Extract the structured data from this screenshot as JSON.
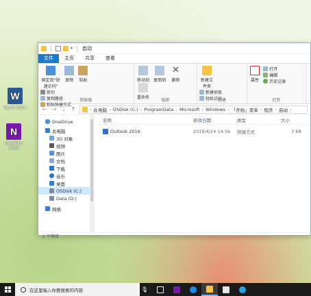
{
  "desktop": {
    "icons": [
      {
        "label": "Word 2016",
        "glyph": "W"
      },
      {
        "label": "OneNote 2016",
        "glyph": "N"
      }
    ]
  },
  "window": {
    "title": "启动",
    "tabs": [
      "文件",
      "主页",
      "共享",
      "查看"
    ],
    "ribbon": {
      "clipboard": {
        "pin": "固定到\"快速访问\"",
        "copy": "复制",
        "paste": "粘贴",
        "cut": "剪切",
        "copy_path": "复制路径",
        "paste_shortcut": "粘贴快捷方式",
        "label": "剪贴板"
      },
      "organize": {
        "move_to": "移动到",
        "copy_to": "复制到",
        "delete": "删除",
        "rename": "重命名",
        "label": "组织"
      },
      "new": {
        "new_folder": "新建文件夹",
        "new_item": "新建项目",
        "easy_access": "轻松访问",
        "label": "新建"
      },
      "open": {
        "properties": "属性",
        "open": "打开",
        "edit": "编辑",
        "history": "历史记录",
        "label": "打开"
      }
    },
    "address": {
      "crumbs": [
        "此电脑",
        "OSDisk (C:)",
        "ProgramData",
        "Microsoft",
        "Windows",
        "「开始」菜单",
        "程序",
        "启动"
      ]
    },
    "nav": {
      "items": [
        {
          "label": "OneDrive",
          "icon": "cloud-icon"
        },
        {
          "label": "此电脑",
          "icon": "computer-icon"
        },
        {
          "label": "3D 对象",
          "icon": "cube-icon"
        },
        {
          "label": "视频",
          "icon": "video-icon"
        },
        {
          "label": "图片",
          "icon": "picture-icon"
        },
        {
          "label": "文档",
          "icon": "document-icon"
        },
        {
          "label": "下载",
          "icon": "download-icon"
        },
        {
          "label": "音乐",
          "icon": "music-icon"
        },
        {
          "label": "桌面",
          "icon": "desktop-icon"
        },
        {
          "label": "OSDisk (C:)",
          "icon": "drive-icon"
        },
        {
          "label": "Data (D:)",
          "icon": "drive-icon"
        },
        {
          "label": "网络",
          "icon": "network-icon"
        }
      ]
    },
    "columns": [
      "名称",
      "修改日期",
      "类型",
      "大小"
    ],
    "files": [
      {
        "name": "Outlook 2016",
        "date": "2019/4/24 14:56",
        "type": "快捷方式",
        "size": "3 KB"
      }
    ],
    "status": "1 个项目"
  },
  "taskbar": {
    "search_placeholder": "在这里输入你要搜索的内容"
  }
}
